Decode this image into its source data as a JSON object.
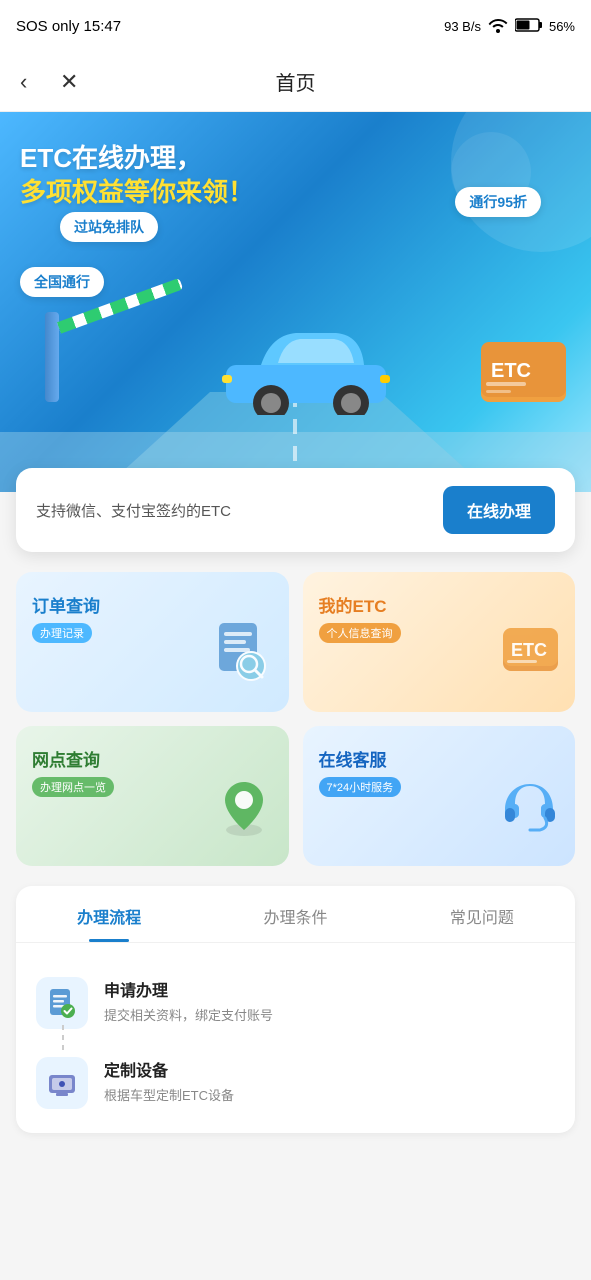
{
  "statusBar": {
    "leftText": "SOS only 15:47",
    "speed": "93 B/s",
    "battery": "56%"
  },
  "navBar": {
    "title": "首页",
    "backLabel": "‹",
    "closeLabel": "✕"
  },
  "banner": {
    "title1": "ETC在线办理，",
    "title2": "多项权益等你来领！",
    "badge1": "过站免排队",
    "badge2": "通行95折",
    "badge3": "全国通行"
  },
  "ctaStrip": {
    "text": "支持微信、支付宝签约的ETC",
    "buttonLabel": "在线办理"
  },
  "menuCards": [
    {
      "title": "订单查询",
      "sub": "办理记录",
      "icon": "🔍",
      "iconBg": "#d0eaff"
    },
    {
      "title": "我的ETC",
      "sub": "个人信息查询",
      "icon": "💳",
      "iconBg": "#ffe0b2"
    },
    {
      "title": "网点查询",
      "sub": "办理网点一览",
      "icon": "📍",
      "iconBg": "#c8e6c9"
    },
    {
      "title": "在线客服",
      "sub": "7*24小时服务",
      "icon": "🎧",
      "iconBg": "#cce4ff"
    }
  ],
  "tabs": [
    {
      "label": "办理流程",
      "active": true
    },
    {
      "label": "办理条件",
      "active": false
    },
    {
      "label": "常见问题",
      "active": false
    }
  ],
  "processList": [
    {
      "icon": "📋",
      "title": "申请办理",
      "desc": "提交相关资料，绑定支付账号"
    },
    {
      "icon": "📦",
      "title": "定制设备",
      "desc": "根据车型定制ETC设备"
    }
  ]
}
